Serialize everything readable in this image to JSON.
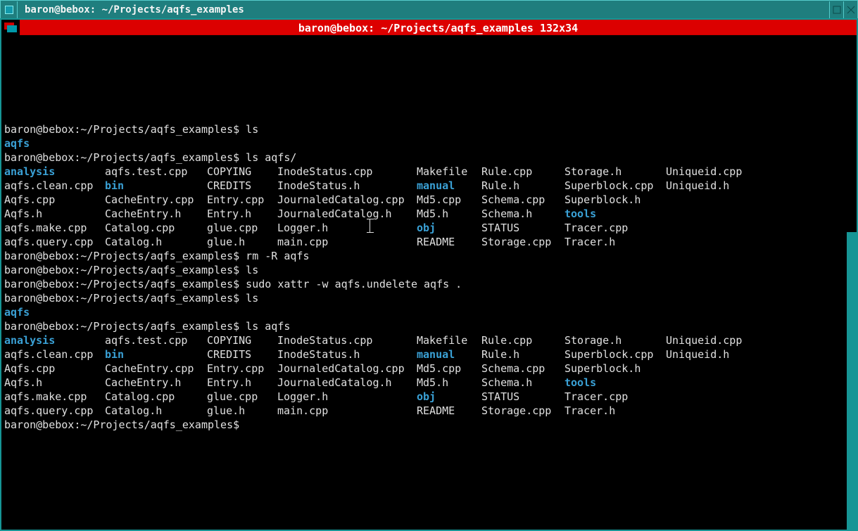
{
  "titlebar": {
    "title": "baron@bebox: ~/Projects/aqfs_examples"
  },
  "size_badge": "baron@bebox: ~/Projects/aqfs_examples 132x34",
  "prompt": "baron@bebox:~/Projects/aqfs_examples$",
  "cmds": {
    "ls": "ls",
    "ls_aqfs_slash": "ls aqfs/",
    "rm": "rm -R aqfs",
    "xattr": "sudo xattr -w aqfs.undelete aqfs .",
    "ls_aqfs": "ls aqfs"
  },
  "single": {
    "aqfs": "aqfs"
  },
  "listing": [
    [
      "analysis",
      "aqfs.test.cpp",
      "COPYING",
      "InodeStatus.cpp",
      "Makefile",
      "Rule.cpp",
      "Storage.h",
      "Uniqueid.cpp"
    ],
    [
      "aqfs.clean.cpp",
      "bin",
      "CREDITS",
      "InodeStatus.h",
      "manual",
      "Rule.h",
      "Superblock.cpp",
      "Uniqueid.h"
    ],
    [
      "Aqfs.cpp",
      "CacheEntry.cpp",
      "Entry.cpp",
      "JournaledCatalog.cpp",
      "Md5.cpp",
      "Schema.cpp",
      "Superblock.h",
      ""
    ],
    [
      "Aqfs.h",
      "CacheEntry.h",
      "Entry.h",
      "JournaledCatalog.h",
      "Md5.h",
      "Schema.h",
      "tools",
      ""
    ],
    [
      "aqfs.make.cpp",
      "Catalog.cpp",
      "glue.cpp",
      "Logger.h",
      "obj",
      "STATUS",
      "Tracer.cpp",
      ""
    ],
    [
      "aqfs.query.cpp",
      "Catalog.h",
      "glue.h",
      "main.cpp",
      "README",
      "Storage.cpp",
      "Tracer.h",
      ""
    ]
  ],
  "dirs": [
    "analysis",
    "bin",
    "manual",
    "tools",
    "obj",
    "aqfs"
  ]
}
